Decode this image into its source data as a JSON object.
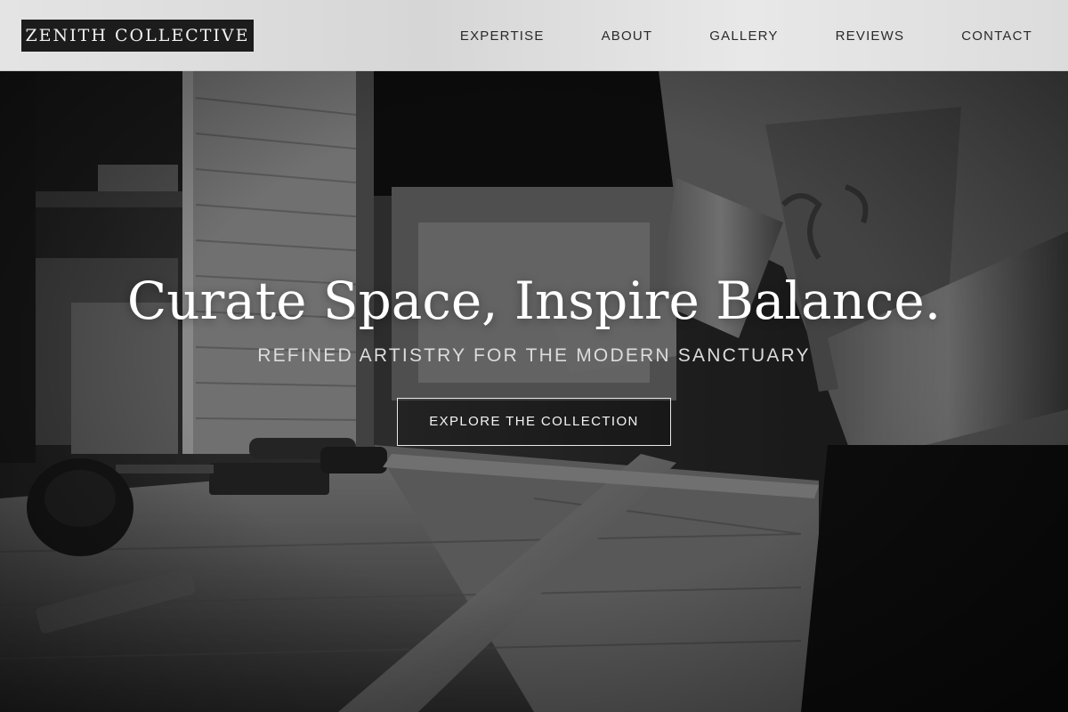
{
  "brand": {
    "logo_text": "ZENITH COLLECTIVE"
  },
  "nav": {
    "items": [
      {
        "label": "EXPERTISE"
      },
      {
        "label": "ABOUT"
      },
      {
        "label": "GALLERY"
      },
      {
        "label": "REVIEWS"
      },
      {
        "label": "CONTACT"
      }
    ]
  },
  "hero": {
    "headline": "Curate Space, Inspire Balance.",
    "subheadline": "REFINED ARTISTRY FOR THE MODERN SANCTUARY",
    "cta_label": "EXPLORE THE COLLECTION"
  },
  "colors": {
    "header_bg": "#e0e0e0",
    "logo_bg": "#1c1c1c",
    "text_light": "#ffffff",
    "text_dark": "#2a2a2a"
  }
}
